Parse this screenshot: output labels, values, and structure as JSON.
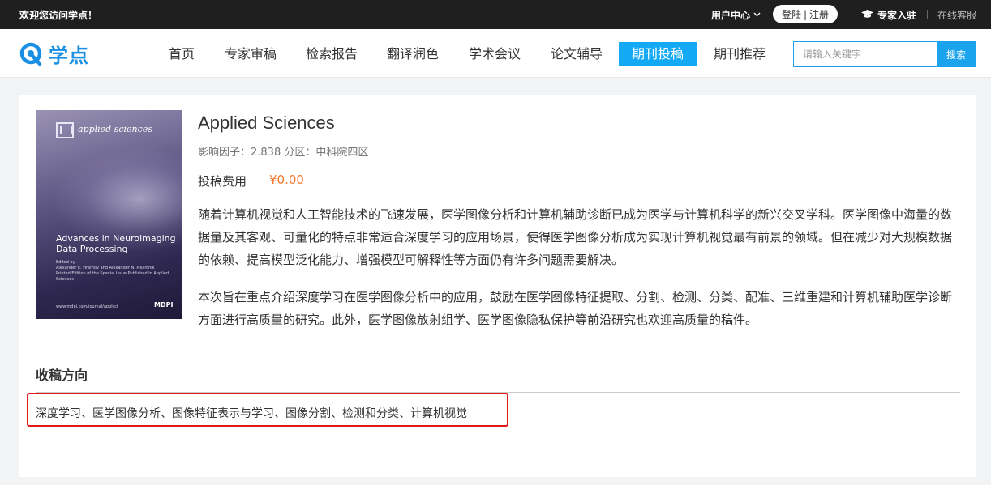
{
  "topbar": {
    "welcome": "欢迎您访问学点！",
    "user_center": "用户中心",
    "login": "登陆",
    "register": "注册",
    "auth_sep": "|",
    "expert": "专家入驻",
    "service": "在线客服"
  },
  "logo": {
    "text": "学点"
  },
  "nav": {
    "items": [
      {
        "label": "首页"
      },
      {
        "label": "专家审稿"
      },
      {
        "label": "检索报告"
      },
      {
        "label": "翻译润色"
      },
      {
        "label": "学术会议"
      },
      {
        "label": "论文辅导"
      },
      {
        "label": "期刊投稿"
      },
      {
        "label": "期刊推荐"
      }
    ],
    "active": "期刊投稿"
  },
  "search": {
    "placeholder": "请输入关键字",
    "button": "搜索"
  },
  "cover": {
    "brand": "applied sciences",
    "title": "Advances in Neuroimaging Data Processing",
    "editors_label": "Edited by",
    "editors": "Alexander E. Hramov and Alexander N. Pisarchik",
    "subtitle": "Printed Edition of the Special Issue Published in Applied Sciences",
    "url": "www.mdpi.com/journal/applsci",
    "publisher": "MDPI"
  },
  "journal": {
    "title": "Applied Sciences",
    "meta": "影响因子：2.838 分区：中科院四区",
    "fee_label": "投稿费用",
    "fee_value": "¥0.00",
    "desc1": "随着计算机视觉和人工智能技术的飞速发展，医学图像分析和计算机辅助诊断已成为医学与计算机科学的新兴交叉学科。医学图像中海量的数据量及其客观、可量化的特点非常适合深度学习的应用场景，使得医学图像分析成为实现计算机视觉最有前景的领域。但在减少对大规模数据的依赖、提高模型泛化能力、增强模型可解释性等方面仍有许多问题需要解决。",
    "desc2": "本次旨在重点介绍深度学习在医学图像分析中的应用，鼓励在医学图像特征提取、分割、检测、分类、配准、三维重建和计算机辅助医学诊断方面进行高质量的研究。此外，医学图像放射组学、医学图像隐私保护等前沿研究也欢迎高质量的稿件。"
  },
  "scope": {
    "heading": "收稿方向",
    "text": "深度学习、医学图像分析、图像特征表示与学习、图像分割、检测和分类、计算机视觉"
  },
  "colors": {
    "accent": "#13a9f5",
    "brand": "#1a8fe3",
    "price": "#f5762a",
    "highlight_border": "#e01a1a",
    "topbar_bg": "#1f1f1f"
  }
}
